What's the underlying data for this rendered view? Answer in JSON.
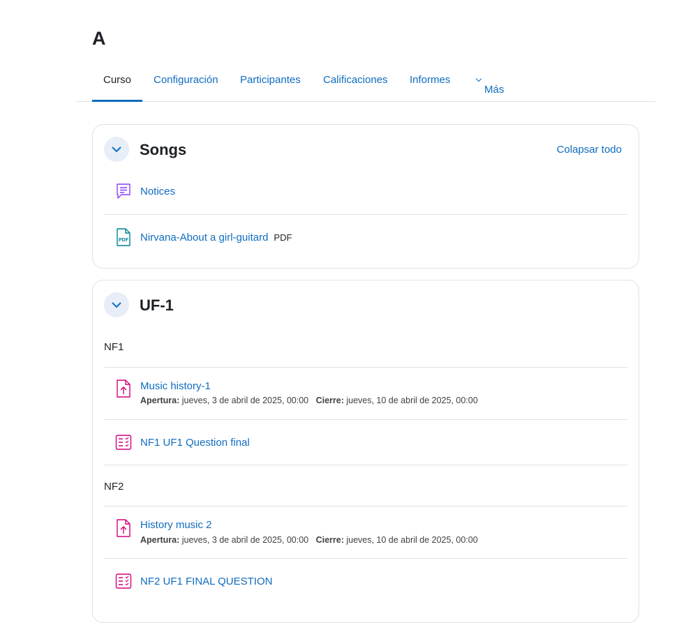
{
  "course": {
    "title": "A"
  },
  "tabs": [
    {
      "label": "Curso"
    },
    {
      "label": "Configuración"
    },
    {
      "label": "Participantes"
    },
    {
      "label": "Calificaciones"
    },
    {
      "label": "Informes"
    },
    {
      "label": "Más"
    }
  ],
  "sections": [
    {
      "title": "Songs",
      "collapse_all": "Colapsar todo",
      "activities": [
        {
          "name": "Notices",
          "icon": "forum-icon"
        },
        {
          "name": "Nirvana-About a girl-guitard",
          "badge": "PDF",
          "icon": "pdf-icon"
        }
      ]
    },
    {
      "title": "UF-1",
      "subsections": [
        {
          "heading": "NF1",
          "activities": [
            {
              "name": "Music history-1",
              "icon": "assignment-icon",
              "open_label": "Apertura:",
              "open_date": "jueves, 3 de abril de 2025, 00:00",
              "close_label": "Cierre:",
              "close_date": "jueves, 10 de abril de 2025, 00:00"
            },
            {
              "name": "NF1 UF1 Question final",
              "icon": "quiz-icon"
            }
          ]
        },
        {
          "heading": "NF2",
          "activities": [
            {
              "name": "History music 2",
              "icon": "assignment-icon",
              "open_label": "Apertura:",
              "open_date": "jueves, 3 de abril de 2025, 00:00",
              "close_label": "Cierre:",
              "close_date": "jueves, 10 de abril de 2025, 00:00"
            },
            {
              "name": "NF2 UF1 FINAL QUESTION",
              "icon": "quiz-icon"
            }
          ]
        }
      ]
    }
  ],
  "colors": {
    "link": "#0f6cbf",
    "forum": "#8a3ffc",
    "resource": "#008196",
    "assessment": "#d4007a"
  }
}
